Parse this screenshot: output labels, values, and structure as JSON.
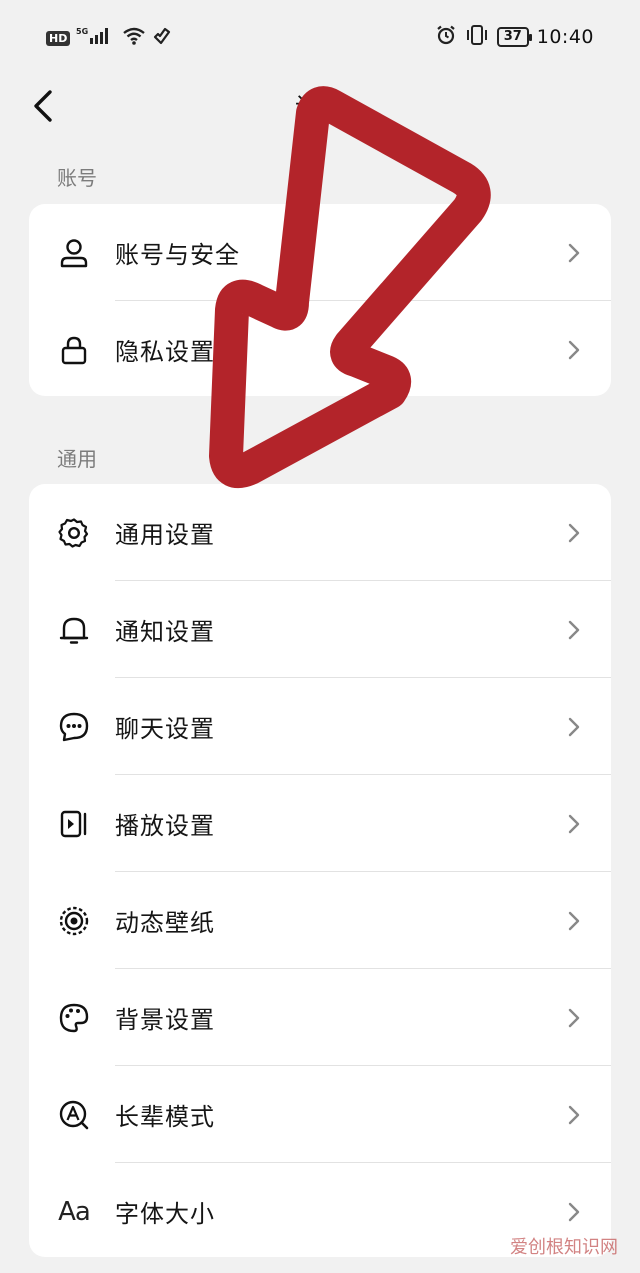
{
  "status_bar": {
    "network_badge": "HD",
    "network_type": "5G",
    "battery_level": "37",
    "time": "10:40"
  },
  "header": {
    "title": "设置"
  },
  "sections": [
    {
      "label": "账号",
      "items": [
        {
          "label": "账号与安全",
          "icon": "user-icon"
        },
        {
          "label": "隐私设置",
          "icon": "lock-icon"
        }
      ]
    },
    {
      "label": "通用",
      "items": [
        {
          "label": "通用设置",
          "icon": "gear-icon"
        },
        {
          "label": "通知设置",
          "icon": "bell-icon"
        },
        {
          "label": "聊天设置",
          "icon": "chat-bubble-icon"
        },
        {
          "label": "播放设置",
          "icon": "play-icon"
        },
        {
          "label": "动态壁纸",
          "icon": "live-wallpaper-icon"
        },
        {
          "label": "背景设置",
          "icon": "palette-icon"
        },
        {
          "label": "长辈模式",
          "icon": "elder-mode-icon"
        },
        {
          "label": "字体大小",
          "icon": "font-size-icon",
          "icon_text": "Aa"
        }
      ]
    }
  ],
  "watermark": "爱创根知识网",
  "colors": {
    "background": "#f1f1f1",
    "card": "#ffffff",
    "annotation_arrow": "#b3242a",
    "section_label": "#7c7c7c"
  }
}
